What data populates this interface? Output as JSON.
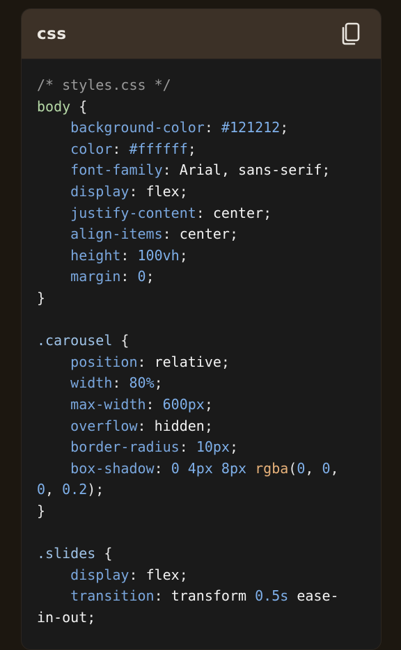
{
  "header": {
    "language": "css",
    "copy_icon": "copy-icon"
  },
  "colors": {
    "page_bg": "#1c1710",
    "header_bg": "#3c3127",
    "code_bg": "#1a1a1a",
    "property": "#7aa7de",
    "selector": "#b5d8a6",
    "function": "#e8b27a",
    "comment": "#9a9a9a"
  },
  "code": {
    "lines": [
      [
        {
          "t": "/* styles.css */",
          "k": "comment"
        }
      ],
      [
        {
          "t": "body",
          "k": "sel"
        },
        {
          "t": " {",
          "k": "punc"
        }
      ],
      [
        {
          "t": "    ",
          "k": "punc"
        },
        {
          "t": "background-color",
          "k": "prop"
        },
        {
          "t": ": ",
          "k": "punc"
        },
        {
          "t": "#121212",
          "k": "num"
        },
        {
          "t": ";",
          "k": "punc"
        }
      ],
      [
        {
          "t": "    ",
          "k": "punc"
        },
        {
          "t": "color",
          "k": "prop"
        },
        {
          "t": ": ",
          "k": "punc"
        },
        {
          "t": "#ffffff",
          "k": "num"
        },
        {
          "t": ";",
          "k": "punc"
        }
      ],
      [
        {
          "t": "    ",
          "k": "punc"
        },
        {
          "t": "font-family",
          "k": "prop"
        },
        {
          "t": ": ",
          "k": "punc"
        },
        {
          "t": "Arial, sans-serif",
          "k": "val"
        },
        {
          "t": ";",
          "k": "punc"
        }
      ],
      [
        {
          "t": "    ",
          "k": "punc"
        },
        {
          "t": "display",
          "k": "prop"
        },
        {
          "t": ": ",
          "k": "punc"
        },
        {
          "t": "flex",
          "k": "val"
        },
        {
          "t": ";",
          "k": "punc"
        }
      ],
      [
        {
          "t": "    ",
          "k": "punc"
        },
        {
          "t": "justify-content",
          "k": "prop"
        },
        {
          "t": ": ",
          "k": "punc"
        },
        {
          "t": "center",
          "k": "val"
        },
        {
          "t": ";",
          "k": "punc"
        }
      ],
      [
        {
          "t": "    ",
          "k": "punc"
        },
        {
          "t": "align-items",
          "k": "prop"
        },
        {
          "t": ": ",
          "k": "punc"
        },
        {
          "t": "center",
          "k": "val"
        },
        {
          "t": ";",
          "k": "punc"
        }
      ],
      [
        {
          "t": "    ",
          "k": "punc"
        },
        {
          "t": "height",
          "k": "prop"
        },
        {
          "t": ": ",
          "k": "punc"
        },
        {
          "t": "100vh",
          "k": "num"
        },
        {
          "t": ";",
          "k": "punc"
        }
      ],
      [
        {
          "t": "    ",
          "k": "punc"
        },
        {
          "t": "margin",
          "k": "prop"
        },
        {
          "t": ": ",
          "k": "punc"
        },
        {
          "t": "0",
          "k": "num"
        },
        {
          "t": ";",
          "k": "punc"
        }
      ],
      [
        {
          "t": "}",
          "k": "punc"
        }
      ],
      [],
      [
        {
          "t": ".carousel",
          "k": "class"
        },
        {
          "t": " {",
          "k": "punc"
        }
      ],
      [
        {
          "t": "    ",
          "k": "punc"
        },
        {
          "t": "position",
          "k": "prop"
        },
        {
          "t": ": ",
          "k": "punc"
        },
        {
          "t": "relative",
          "k": "val"
        },
        {
          "t": ";",
          "k": "punc"
        }
      ],
      [
        {
          "t": "    ",
          "k": "punc"
        },
        {
          "t": "width",
          "k": "prop"
        },
        {
          "t": ": ",
          "k": "punc"
        },
        {
          "t": "80%",
          "k": "num"
        },
        {
          "t": ";",
          "k": "punc"
        }
      ],
      [
        {
          "t": "    ",
          "k": "punc"
        },
        {
          "t": "max-width",
          "k": "prop"
        },
        {
          "t": ": ",
          "k": "punc"
        },
        {
          "t": "600px",
          "k": "num"
        },
        {
          "t": ";",
          "k": "punc"
        }
      ],
      [
        {
          "t": "    ",
          "k": "punc"
        },
        {
          "t": "overflow",
          "k": "prop"
        },
        {
          "t": ": ",
          "k": "punc"
        },
        {
          "t": "hidden",
          "k": "val"
        },
        {
          "t": ";",
          "k": "punc"
        }
      ],
      [
        {
          "t": "    ",
          "k": "punc"
        },
        {
          "t": "border-radius",
          "k": "prop"
        },
        {
          "t": ": ",
          "k": "punc"
        },
        {
          "t": "10px",
          "k": "num"
        },
        {
          "t": ";",
          "k": "punc"
        }
      ],
      [
        {
          "t": "    ",
          "k": "punc"
        },
        {
          "t": "box-shadow",
          "k": "prop"
        },
        {
          "t": ": ",
          "k": "punc"
        },
        {
          "t": "0 4px 8px",
          "k": "num"
        },
        {
          "t": " ",
          "k": "punc"
        },
        {
          "t": "rgba",
          "k": "func"
        },
        {
          "t": "(",
          "k": "punc"
        },
        {
          "t": "0",
          "k": "num"
        },
        {
          "t": ", ",
          "k": "punc"
        },
        {
          "t": "0",
          "k": "num"
        },
        {
          "t": ",",
          "k": "punc"
        }
      ],
      [
        {
          "t": "0",
          "k": "num"
        },
        {
          "t": ", ",
          "k": "punc"
        },
        {
          "t": "0.2",
          "k": "num"
        },
        {
          "t": ");",
          "k": "punc"
        }
      ],
      [
        {
          "t": "}",
          "k": "punc"
        }
      ],
      [],
      [
        {
          "t": ".slides",
          "k": "class"
        },
        {
          "t": " {",
          "k": "punc"
        }
      ],
      [
        {
          "t": "    ",
          "k": "punc"
        },
        {
          "t": "display",
          "k": "prop"
        },
        {
          "t": ": ",
          "k": "punc"
        },
        {
          "t": "flex",
          "k": "val"
        },
        {
          "t": ";",
          "k": "punc"
        }
      ],
      [
        {
          "t": "    ",
          "k": "punc"
        },
        {
          "t": "transition",
          "k": "prop"
        },
        {
          "t": ": ",
          "k": "punc"
        },
        {
          "t": "transform ",
          "k": "val"
        },
        {
          "t": "0.5s",
          "k": "num"
        },
        {
          "t": " ease-",
          "k": "val"
        }
      ],
      [
        {
          "t": "in-out;",
          "k": "val"
        }
      ]
    ]
  }
}
